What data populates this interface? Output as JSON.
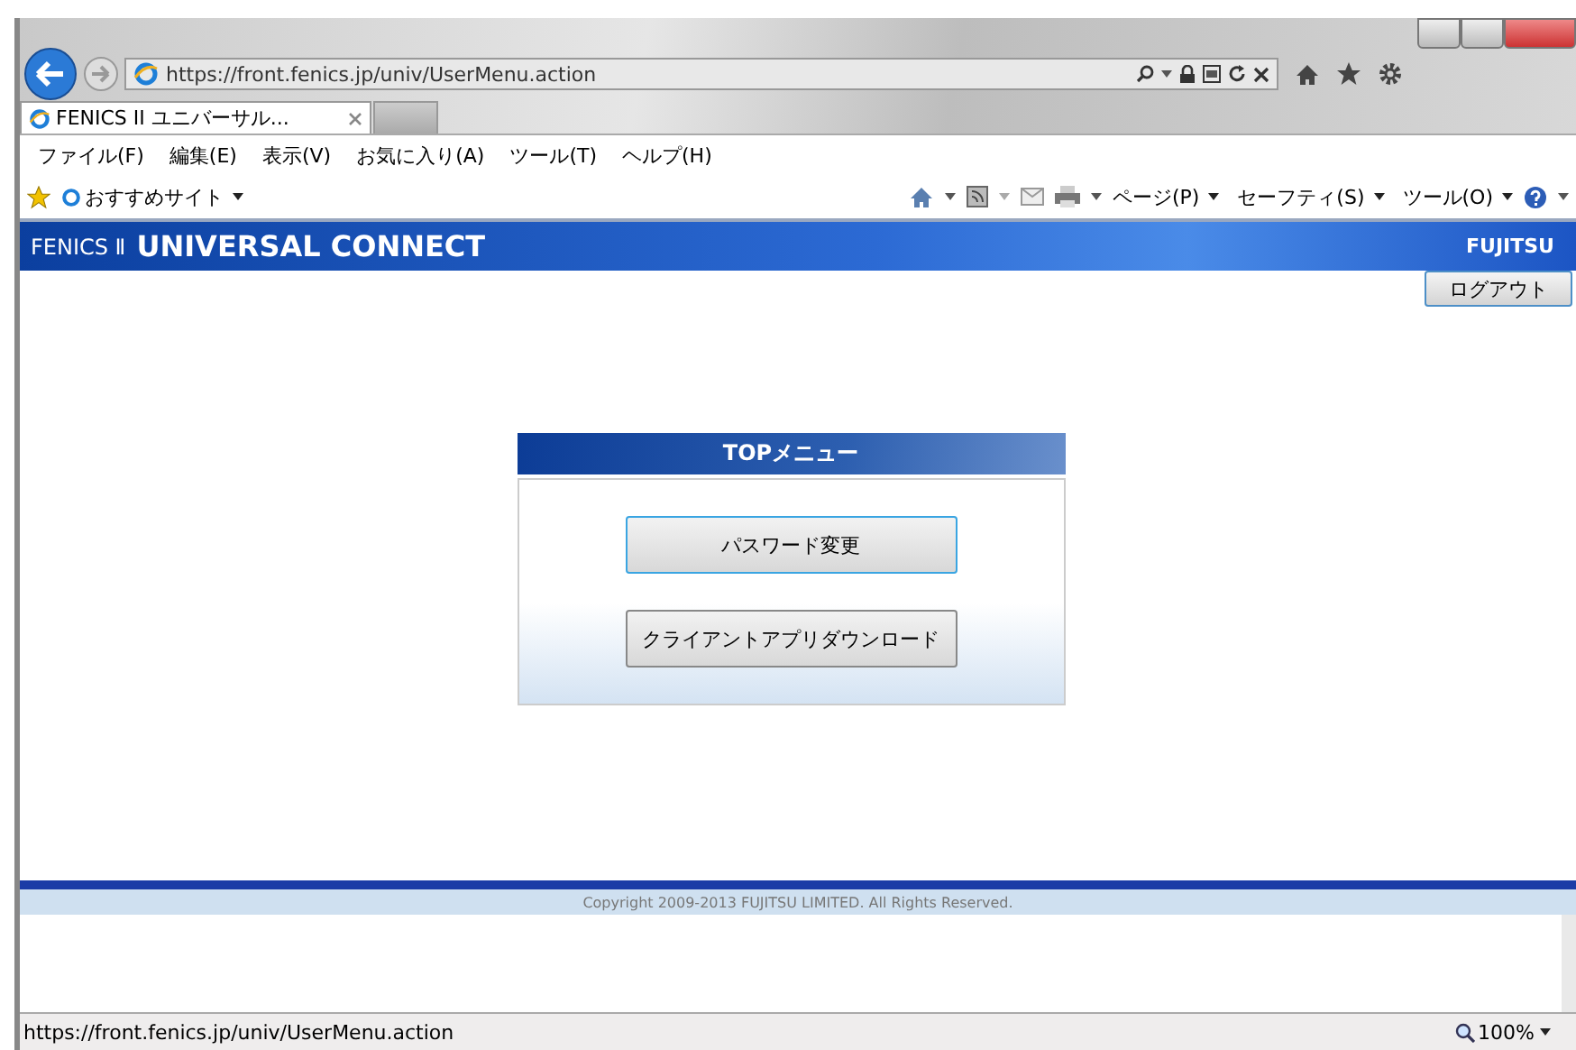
{
  "browser": {
    "address": "https://front.fenics.jp/univ/UserMenu.action",
    "tabs": [
      {
        "title": "FENICS II ユニバーサル...",
        "selected": true
      }
    ],
    "menu": [
      "ファイル(F)",
      "編集(E)",
      "表示(V)",
      "お気に入り(A)",
      "ツール(T)",
      "ヘルプ(H)"
    ],
    "favorites": "おすすめサイト",
    "commands": [
      "ページ(P)",
      "セーフティ(S)",
      "ツール(O)"
    ]
  },
  "header": {
    "prefix": "FENICS Ⅱ",
    "title": "UNIVERSAL CONNECT",
    "logo": "FUJITSU"
  },
  "logout": "ログアウト",
  "panel": {
    "title": "TOPメニュー",
    "buttons": [
      {
        "label": "パスワード変更",
        "focused": true
      },
      {
        "label": "クライアントアプリダウンロード",
        "focused": false
      }
    ]
  },
  "footer": "Copyright 2009-2013 FUJITSU LIMITED. All Rights Reserved.",
  "status": {
    "url": "https://front.fenics.jp/univ/UserMenu.action",
    "zoom": "100%"
  }
}
